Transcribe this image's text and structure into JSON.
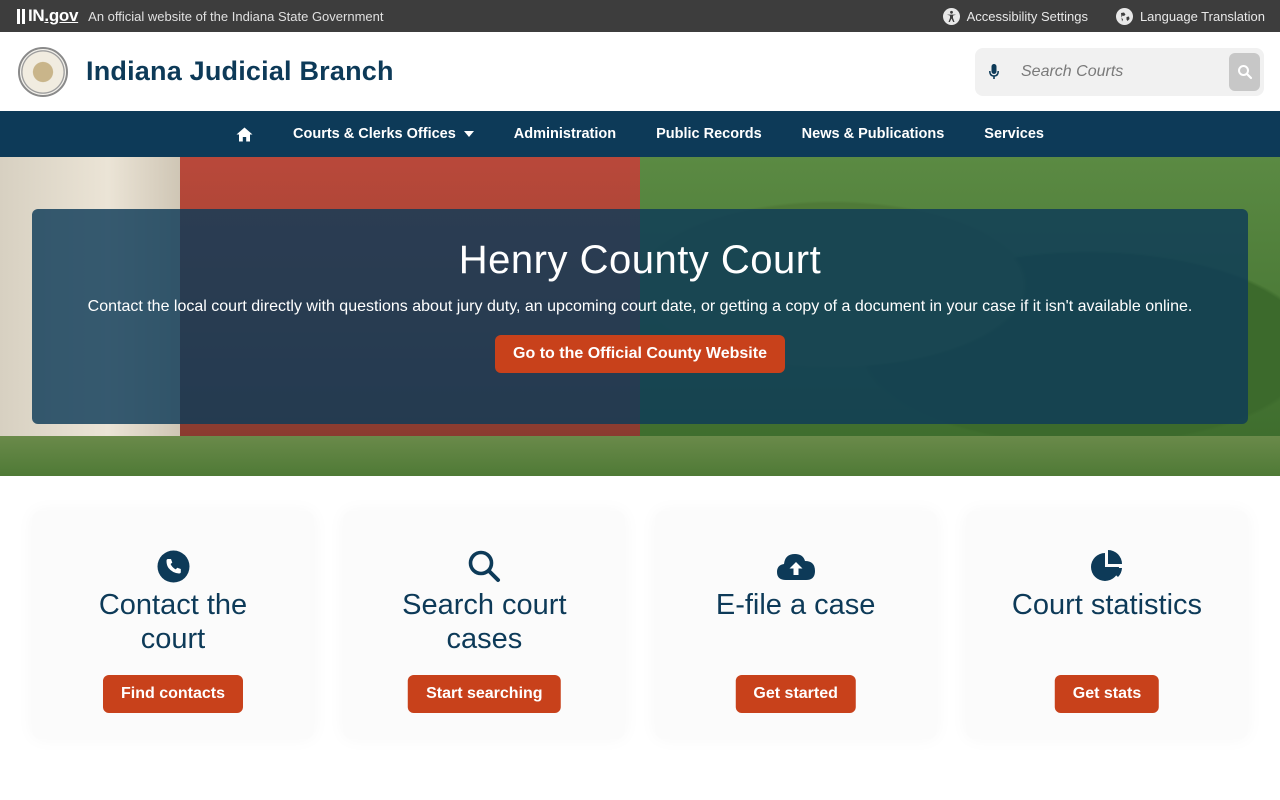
{
  "topbar": {
    "ingov_prefix": "IN",
    "ingov_suffix": ".gov",
    "official_text": "An official website of the Indiana State Government",
    "accessibility_label": "Accessibility Settings",
    "translation_label": "Language Translation"
  },
  "header": {
    "brand": "Indiana Judicial Branch",
    "search_placeholder": "Search Courts"
  },
  "nav": {
    "items": [
      {
        "label": "Courts & Clerks Offices",
        "has_dropdown": true
      },
      {
        "label": "Administration"
      },
      {
        "label": "Public Records"
      },
      {
        "label": "News & Publications"
      },
      {
        "label": "Services"
      }
    ]
  },
  "hero": {
    "title": "Henry County Court",
    "text": "Contact the local court directly with questions about jury duty, an upcoming court date, or getting a copy of a document in your case if it isn't available online.",
    "button": "Go to the Official County Website"
  },
  "cards": [
    {
      "icon": "phone-icon",
      "title": "Contact the court",
      "button": "Find contacts"
    },
    {
      "icon": "search-icon",
      "title": "Search court cases",
      "button": "Start searching"
    },
    {
      "icon": "cloud-upload-icon",
      "title": "E-file a case",
      "button": "Get started"
    },
    {
      "icon": "pie-chart-icon",
      "title": "Court statistics",
      "button": "Get stats"
    }
  ],
  "colors": {
    "navy": "#0d3a58",
    "topbar": "#3d3d3d",
    "accent_orange": "#c8411b"
  }
}
